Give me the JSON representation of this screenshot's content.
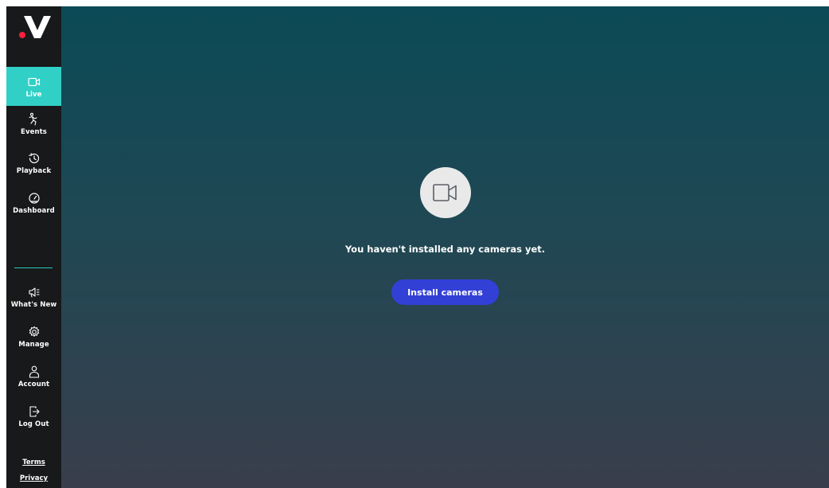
{
  "brand": {
    "logo_letter": "V",
    "logo_dot_color": "#ff1f3d"
  },
  "sidebar": {
    "accent_color": "#30d0c6",
    "items": [
      {
        "label": "Live",
        "icon": "video-camera-icon",
        "active": true
      },
      {
        "label": "Events",
        "icon": "running-person-icon",
        "active": false
      },
      {
        "label": "Playback",
        "icon": "history-clock-icon",
        "active": false
      },
      {
        "label": "Dashboard",
        "icon": "gauge-icon",
        "active": false
      }
    ],
    "bottom_items": [
      {
        "label": "What's New",
        "icon": "megaphone-icon"
      },
      {
        "label": "Manage",
        "icon": "gear-icon"
      },
      {
        "label": "Account",
        "icon": "user-icon"
      },
      {
        "label": "Log Out",
        "icon": "logout-icon"
      }
    ],
    "footer_links": [
      "Terms",
      "Privacy"
    ]
  },
  "main": {
    "empty_state": {
      "icon": "video-camera-icon",
      "message": "You haven't installed any cameras yet.",
      "button_label": "Install cameras",
      "button_color": "#3340d6"
    }
  }
}
